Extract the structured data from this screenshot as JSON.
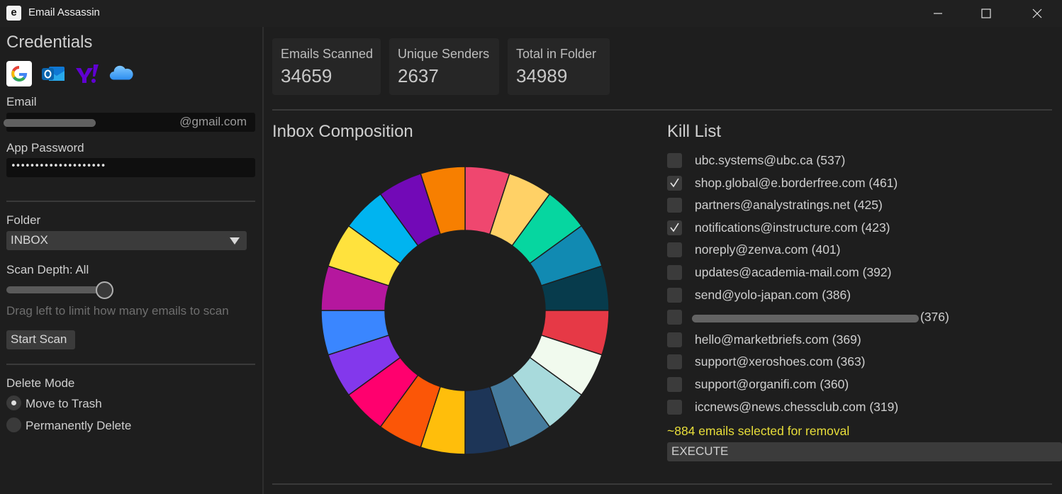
{
  "window": {
    "app_icon_letter": "e",
    "title": "Email Assassin"
  },
  "sidebar": {
    "credentials_title": "Credentials",
    "providers": [
      "google-icon",
      "outlook-icon",
      "yahoo-icon",
      "icloud-icon"
    ],
    "email_label": "Email",
    "email_domain_suffix": "@gmail.com",
    "app_password_label": "App Password",
    "app_password_mask": "••••••••••••••••••••",
    "folder_label": "Folder",
    "folder_value": "INBOX",
    "scan_depth_label": "Scan Depth: All",
    "scan_depth_hint": "Drag left to limit how many emails to scan",
    "scan_depth_level": 1.0,
    "start_scan_label": "Start Scan",
    "delete_mode_title": "Delete Mode",
    "delete_modes": [
      {
        "label": "Move to Trash",
        "selected": true
      },
      {
        "label": "Permanently Delete",
        "selected": false
      }
    ]
  },
  "stats": [
    {
      "label": "Emails Scanned",
      "value": "34659"
    },
    {
      "label": "Unique Senders",
      "value": "2637"
    },
    {
      "label": "Total in Folder",
      "value": "34989"
    }
  ],
  "composition": {
    "title": "Inbox Composition",
    "segment_colors": [
      "#ef476f",
      "#ffd166",
      "#06d6a0",
      "#118ab2",
      "#073b4c",
      "#e63946",
      "#f1faee",
      "#a8dadc",
      "#457b9d",
      "#1d3557",
      "#ffbe0b",
      "#fb5607",
      "#ff006e",
      "#8338ec",
      "#3a86ff",
      "#b5179e",
      "#ffe23d",
      "#00b4f0",
      "#7209b7",
      "#f77f00"
    ]
  },
  "kill_list": {
    "title": "Kill List",
    "items": [
      {
        "label": "ubc.systems@ubc.ca (537)",
        "checked": false
      },
      {
        "label": "shop.global@e.borderfree.com (461)",
        "checked": true
      },
      {
        "label": "partners@analystratings.net (425)",
        "checked": false
      },
      {
        "label": "notifications@instructure.com (423)",
        "checked": true
      },
      {
        "label": "noreply@zenva.com (401)",
        "checked": false
      },
      {
        "label": "updates@academia-mail.com (392)",
        "checked": false
      },
      {
        "label": "send@yolo-japan.com (386)",
        "checked": false
      },
      {
        "label": "(376)",
        "checked": false,
        "redacted": true
      },
      {
        "label": "hello@marketbriefs.com (369)",
        "checked": false
      },
      {
        "label": "support@xeroshoes.com (363)",
        "checked": false
      },
      {
        "label": "support@organifi.com (360)",
        "checked": false
      },
      {
        "label": "iccnews@news.chessclub.com (319)",
        "checked": false
      }
    ],
    "summary": "~884 emails selected for removal",
    "execute_label": "EXECUTE"
  },
  "colors": {
    "accent_summary": "#e9df3a",
    "background": "#1e1e1e"
  }
}
